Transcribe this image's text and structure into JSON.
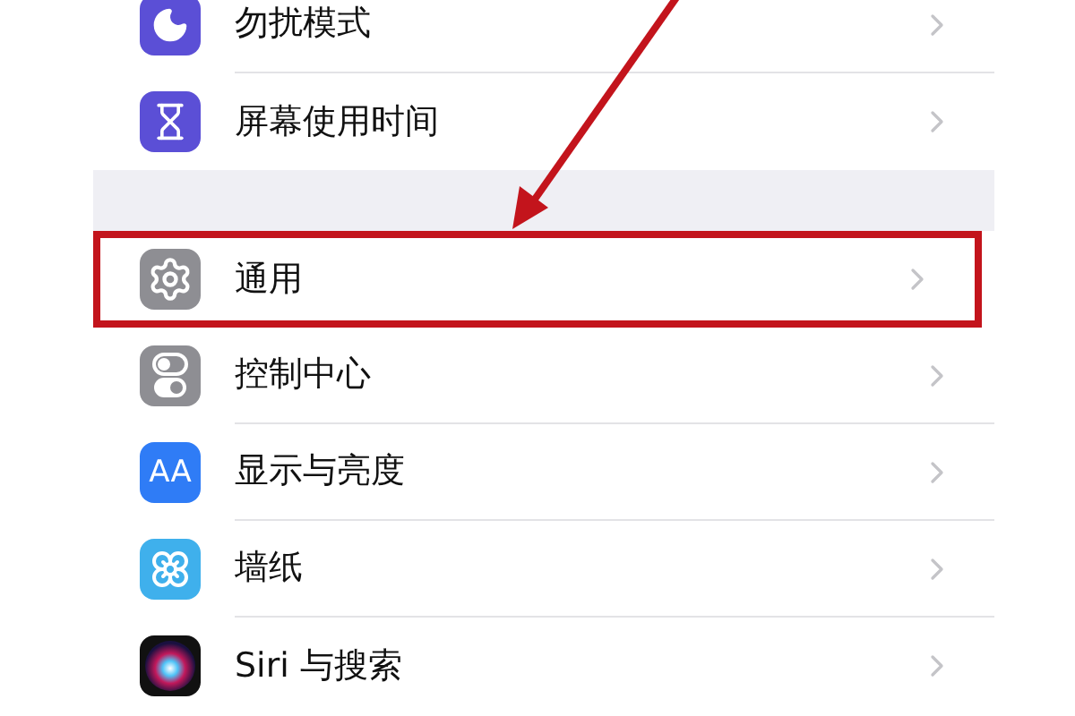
{
  "groups": [
    {
      "items": [
        {
          "label": "勿扰模式",
          "kind": "moon",
          "highlighted": false
        },
        {
          "label": "屏幕使用时间",
          "kind": "hourglass",
          "highlighted": false
        }
      ]
    },
    {
      "items": [
        {
          "label": "通用",
          "kind": "gear",
          "highlighted": true
        },
        {
          "label": "控制中心",
          "kind": "switches",
          "highlighted": false
        },
        {
          "label": "显示与亮度",
          "kind": "display",
          "icon_text": "AA",
          "highlighted": false
        },
        {
          "label": "墙纸",
          "kind": "flower",
          "highlighted": false
        },
        {
          "label": "Siri 与搜索",
          "kind": "siri",
          "highlighted": false
        }
      ]
    }
  ]
}
